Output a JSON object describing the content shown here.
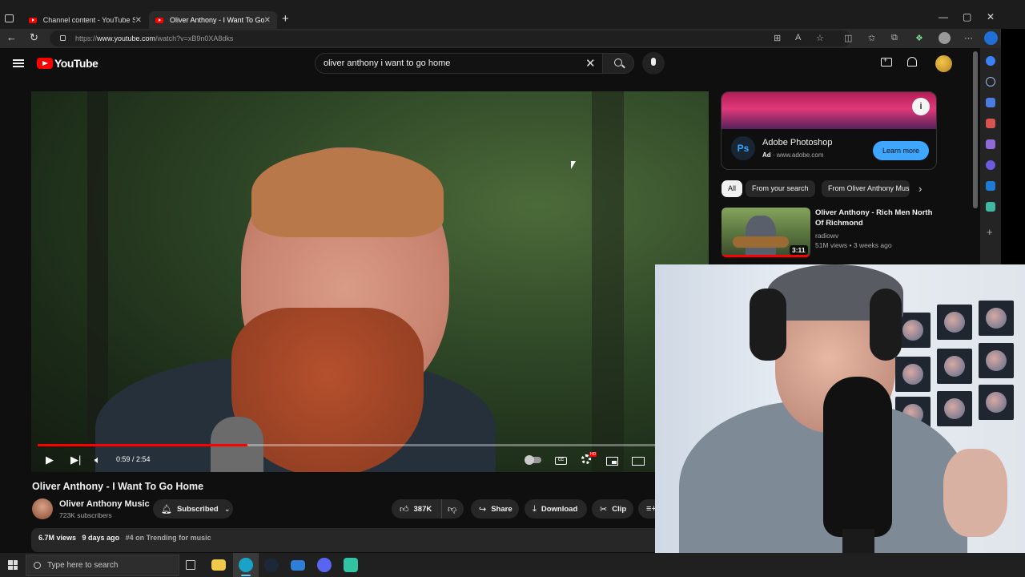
{
  "browser": {
    "tabs": [
      {
        "label": "Channel content - YouTube Studio"
      },
      {
        "label": "Oliver Anthony - I Want To Go Home"
      }
    ],
    "url_host": "www.youtube.com",
    "url_prefix": "https://",
    "url_path": "/watch?v=xB9n0XA8dks"
  },
  "youtube": {
    "logo_text": "YouTube",
    "search_value": "oliver anthony i want to go home"
  },
  "player": {
    "time": "0:59 / 2:54",
    "progress_fraction": 0.339,
    "hd_badge": "HD",
    "cc_label": "CC"
  },
  "video": {
    "title": "Oliver Anthony - I Want To Go Home",
    "channel": "Oliver Anthony Music",
    "subscribers": "723K subscribers",
    "subscribed_label": "Subscribed",
    "likes": "387K",
    "share_label": "Share",
    "download_label": "Download",
    "clip_label": "Clip",
    "views": "6.7M views",
    "age": "9 days ago",
    "trending": "#4 on Trending for music"
  },
  "ad": {
    "logo": "Ps",
    "title": "Adobe Photoshop",
    "ad_label": "Ad",
    "domain": "www.adobe.com",
    "cta": "Learn more"
  },
  "chips": [
    "All",
    "From your search",
    "From Oliver Anthony Music"
  ],
  "recommendation": {
    "title": "Oliver Anthony - Rich Men North Of Richmond",
    "channel": "radiowv",
    "views": "51M views",
    "age": "3 weeks ago",
    "duration": "3:11"
  },
  "taskbar": {
    "search_placeholder": "Type here to search"
  },
  "colors": {
    "yt_red": "#ff0000",
    "bg": "#0f0f0f",
    "ad_cta": "#3ea6ff"
  }
}
